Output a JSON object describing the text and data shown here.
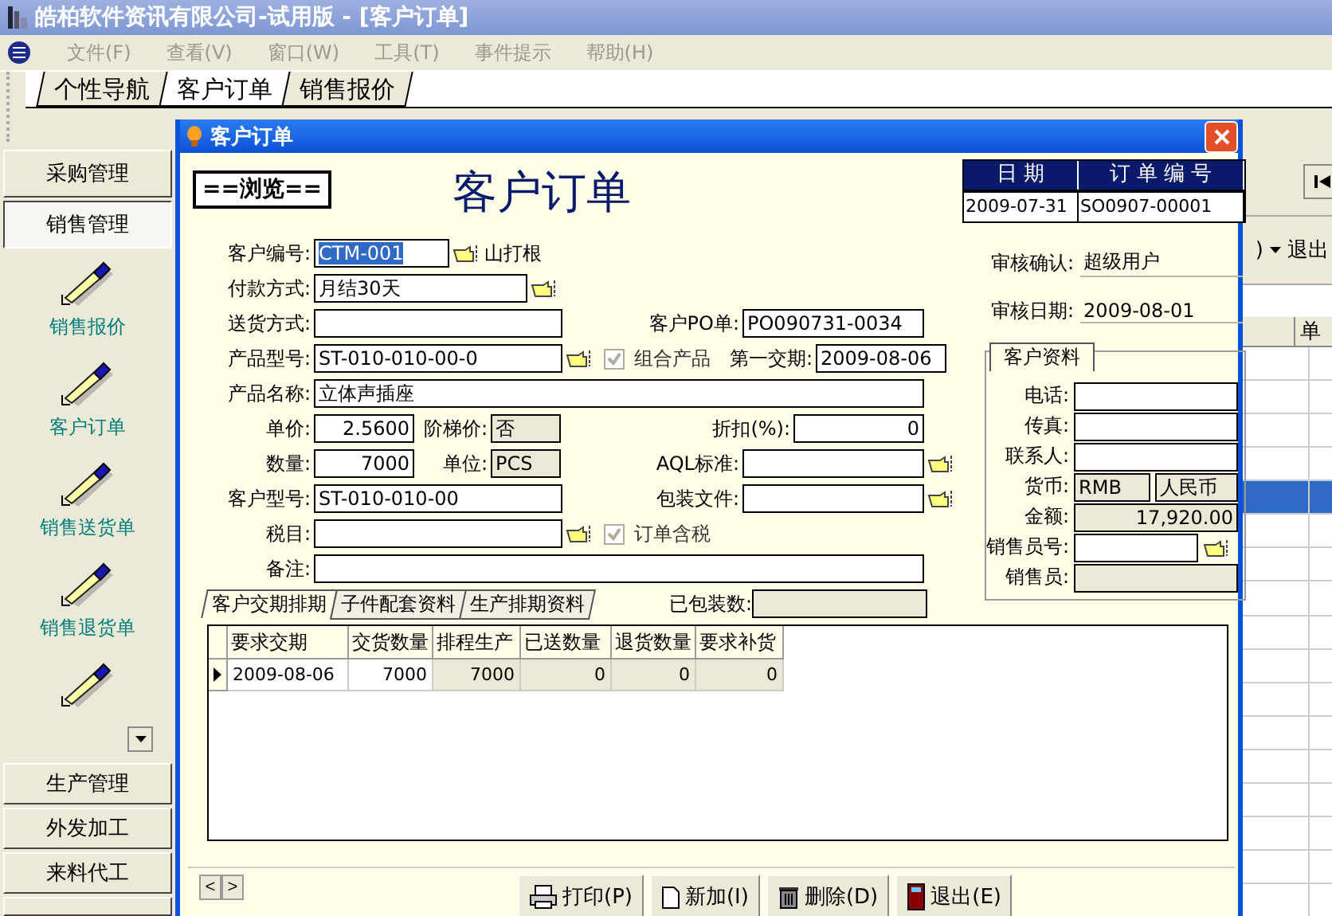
{
  "app_title": "皓柏软件资讯有限公司-试用版 - [客户订单]",
  "menu": [
    {
      "label": "文件(F)",
      "disabled": true
    },
    {
      "label": "查看(V)",
      "disabled": true
    },
    {
      "label": "窗口(W)",
      "disabled": true
    },
    {
      "label": "工具(T)",
      "disabled": true
    },
    {
      "label": "事件提示",
      "disabled": true
    },
    {
      "label": "帮助(H)",
      "disabled": true
    }
  ],
  "doc_tabs": [
    {
      "label": "个性导航",
      "selected": false
    },
    {
      "label": "客户订单",
      "selected": true
    },
    {
      "label": "销售报价",
      "selected": false
    }
  ],
  "sidebar": {
    "top_groups": [
      {
        "label": "采购管理",
        "selected": false
      },
      {
        "label": "销售管理",
        "selected": true
      }
    ],
    "items": [
      {
        "label": "销售报价"
      },
      {
        "label": "客户订单"
      },
      {
        "label": "销售送货单"
      },
      {
        "label": "销售退货单"
      }
    ],
    "bottom_groups": [
      {
        "label": "生产管理"
      },
      {
        "label": "外发加工"
      },
      {
        "label": "来料代工"
      }
    ]
  },
  "background": {
    "toolbar_text": ")",
    "exit_label": "退出",
    "grid_header": "单",
    "grid_rows": [
      {
        "selected": false
      },
      {
        "selected": false
      },
      {
        "selected": false
      },
      {
        "selected": false
      },
      {
        "selected": true
      },
      {
        "selected": false
      },
      {
        "selected": false
      },
      {
        "selected": false
      },
      {
        "selected": false
      },
      {
        "selected": false
      },
      {
        "selected": false
      },
      {
        "selected": false
      },
      {
        "selected": false
      },
      {
        "selected": false
      },
      {
        "selected": false
      },
      {
        "selected": false
      },
      {
        "selected": false
      }
    ]
  },
  "dialog": {
    "title": "客户订单",
    "mode": "==浏览==",
    "heading": "客户订单",
    "date_header": "日 期",
    "number_header": "订 单 编 号",
    "date": "2009-07-31",
    "order_no": "SO0907-00001",
    "customer_no": {
      "label": "客户编号:",
      "value": "CTM-001",
      "focused": true,
      "name": "山打根"
    },
    "payment": {
      "label": "付款方式:",
      "value": "月结30天"
    },
    "delivery": {
      "label": "送货方式:"
    },
    "customer_po": {
      "label": "客户PO单:",
      "value": "PO090731-0034"
    },
    "product_model": {
      "label": "产品型号:",
      "value": "ST-010-010-00-0"
    },
    "combo_product": {
      "label": "组合产品",
      "checked": true,
      "disabled": true
    },
    "first_date": {
      "label": "第一交期:",
      "value": "2009-08-06"
    },
    "product_name": {
      "label": "产品名称:",
      "value": "立体声插座"
    },
    "unit_price": {
      "label": "单价:",
      "value": "2.5600"
    },
    "tier_price": {
      "label": "阶梯价:",
      "value": "否",
      "readonly": true
    },
    "discount": {
      "label": "折扣(%):",
      "value": "0"
    },
    "quantity": {
      "label": "数量:",
      "value": "7000"
    },
    "unit": {
      "label": "单位:",
      "value": "PCS",
      "readonly": true
    },
    "aql": {
      "label": "AQL标准:"
    },
    "customer_model": {
      "label": "客户型号:",
      "value": "ST-010-010-00"
    },
    "packing_file": {
      "label": "包装文件:"
    },
    "tax": {
      "label": "税目:"
    },
    "tax_included": {
      "label": "订单含税",
      "checked": true,
      "disabled": true
    },
    "remark": {
      "label": "备注:"
    },
    "audit_confirm": {
      "label": "审核确认:",
      "value": "超级用户"
    },
    "audit_date": {
      "label": "审核日期:",
      "value": "2009-08-01"
    },
    "customer_group": {
      "tab": "客户资料",
      "phone": {
        "label": "电话:"
      },
      "fax": {
        "label": "传真:"
      },
      "contact": {
        "label": "联系人:"
      },
      "currency": {
        "label": "货币:",
        "code": "RMB",
        "name": "人民币"
      },
      "amount": {
        "label": "金额:",
        "value": "17,920.00"
      },
      "sales_no": {
        "label": "销售员号:"
      },
      "sales_name": {
        "label": "销售员:"
      }
    },
    "detail_tabs": [
      {
        "label": "客户交期排期",
        "selected": true
      },
      {
        "label": "子件配套资料",
        "selected": false
      },
      {
        "label": "生产排期资料",
        "selected": false
      }
    ],
    "packed": {
      "label": "已包装数:"
    },
    "grid": {
      "columns": [
        {
          "label": "要求交期",
          "readonly": false
        },
        {
          "label": "交货数量",
          "readonly": false
        },
        {
          "label": "排程生产",
          "readonly": true
        },
        {
          "label": "已送数量",
          "readonly": true
        },
        {
          "label": "退货数量",
          "readonly": true
        },
        {
          "label": "要求补货",
          "readonly": true
        }
      ],
      "rows": [
        {
          "current": true,
          "cells": [
            "2009-08-06",
            "7000",
            "7000",
            "0",
            "0",
            "0"
          ]
        }
      ]
    },
    "nav": [
      "<",
      ">"
    ],
    "buttons": [
      {
        "kind": "print",
        "label": "打印(P)"
      },
      {
        "kind": "new",
        "label": "新加(I)"
      },
      {
        "kind": "delete",
        "label": "删除(D)"
      },
      {
        "kind": "exit",
        "label": "退出(E)"
      }
    ]
  }
}
